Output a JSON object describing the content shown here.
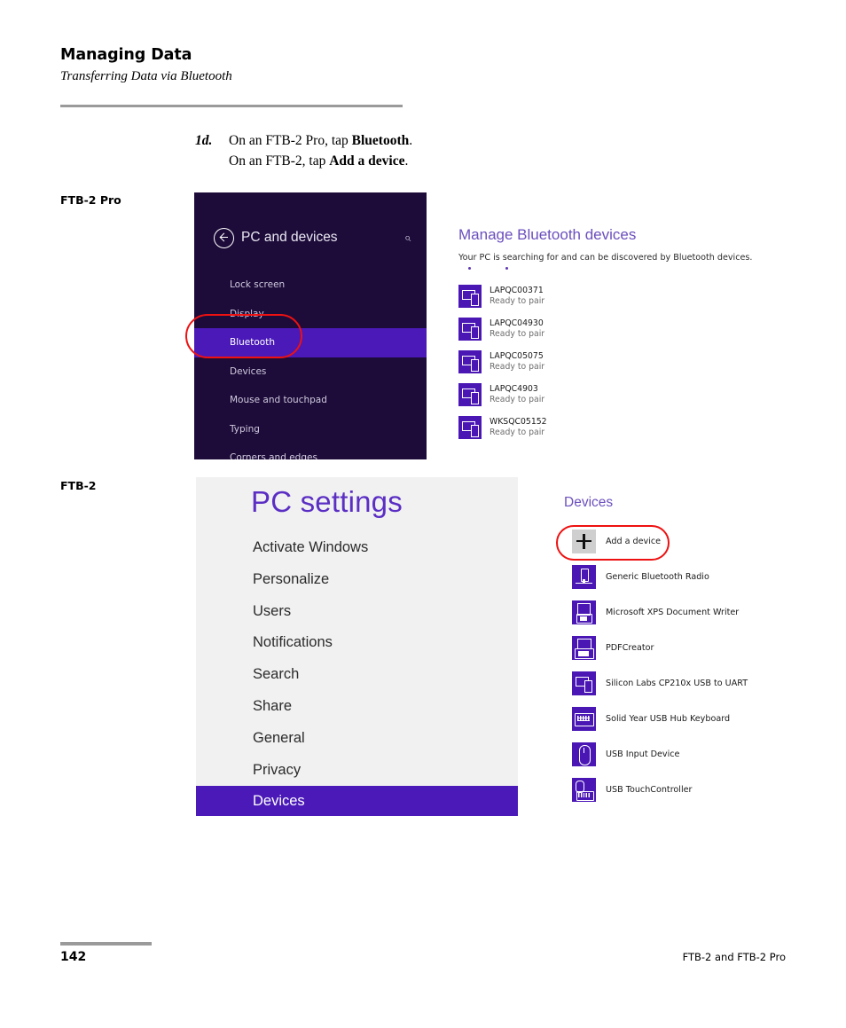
{
  "document": {
    "chapter_title": "Managing Data",
    "section_title": "Transferring Data via Bluetooth",
    "page_number": "142",
    "footer_product": "FTB-2 and FTB-2 Pro"
  },
  "step": {
    "number": "1d.",
    "line1_prefix": "On an FTB-2 Pro, tap ",
    "line1_bold": "Bluetooth",
    "line1_suffix": ".",
    "line2_prefix": "On an FTB-2, tap ",
    "line2_bold": "Add a device",
    "line2_suffix": "."
  },
  "figure_labels": {
    "pro": "FTB-2 Pro",
    "standard": "FTB-2"
  },
  "ftb2pro_screenshot": {
    "titlebar": {
      "back_label": "back-arrow",
      "title": "PC and devices",
      "search_glyph": "⌕"
    },
    "nav_items": [
      {
        "label": "Lock screen",
        "selected": false
      },
      {
        "label": "Display",
        "selected": false
      },
      {
        "label": "Bluetooth",
        "selected": true
      },
      {
        "label": "Devices",
        "selected": false
      },
      {
        "label": "Mouse and touchpad",
        "selected": false
      },
      {
        "label": "Typing",
        "selected": false
      },
      {
        "label": "Corners and edges",
        "selected": false
      }
    ],
    "right_pane": {
      "heading": "Manage Bluetooth devices",
      "status_text": "Your PC is searching for and can be discovered by Bluetooth devices.",
      "devices": [
        {
          "name": "LAPQC00371",
          "status": "Ready to pair",
          "icon": "monitor-phone-icon"
        },
        {
          "name": "LAPQC04930",
          "status": "Ready to pair",
          "icon": "monitor-phone-icon"
        },
        {
          "name": "LAPQC05075",
          "status": "Ready to pair",
          "icon": "monitor-phone-icon"
        },
        {
          "name": "LAPQC4903",
          "status": "Ready to pair",
          "icon": "monitor-phone-icon"
        },
        {
          "name": "WKSQC05152",
          "status": "Ready to pair",
          "icon": "monitor-phone-icon"
        }
      ]
    }
  },
  "ftb2_screenshot": {
    "title": "PC settings",
    "nav_items": [
      {
        "label": "Activate Windows",
        "selected": false
      },
      {
        "label": "Personalize",
        "selected": false
      },
      {
        "label": "Users",
        "selected": false
      },
      {
        "label": "Notifications",
        "selected": false
      },
      {
        "label": "Search",
        "selected": false
      },
      {
        "label": "Share",
        "selected": false
      },
      {
        "label": "General",
        "selected": false
      },
      {
        "label": "Privacy",
        "selected": false
      },
      {
        "label": "Devices",
        "selected": true
      }
    ],
    "right_pane": {
      "heading": "Devices",
      "devices": [
        {
          "name": "Add a device",
          "icon": "plus-icon",
          "is_add": true
        },
        {
          "name": "Generic Bluetooth Radio",
          "icon": "bluetooth-radio-icon",
          "is_add": false
        },
        {
          "name": "Microsoft XPS Document Writer",
          "icon": "document-writer-icon",
          "is_add": false
        },
        {
          "name": "PDFCreator",
          "icon": "printer-icon",
          "is_add": false
        },
        {
          "name": "Silicon Labs CP210x USB to UART",
          "icon": "monitor-phone-icon",
          "is_add": false
        },
        {
          "name": "Solid Year USB Hub Keyboard",
          "icon": "keyboard-icon",
          "is_add": false
        },
        {
          "name": "USB Input Device",
          "icon": "mouse-icon",
          "is_add": false
        },
        {
          "name": "USB TouchController",
          "icon": "mouse-keyboard-icon",
          "is_add": false
        }
      ]
    }
  },
  "annotations": [
    {
      "name": "bluetooth-callout",
      "color": "#ee1111"
    },
    {
      "name": "add-a-device-callout",
      "color": "#ee1111"
    }
  ],
  "colors": {
    "accent_purple": "#4a19b8",
    "dark_panel": "#1d0c3a",
    "heading_purple": "#6b4fbd",
    "title_purple": "#5b2ec4",
    "annotation_red": "#ee1111",
    "light_panel": "#f1f1f1"
  }
}
